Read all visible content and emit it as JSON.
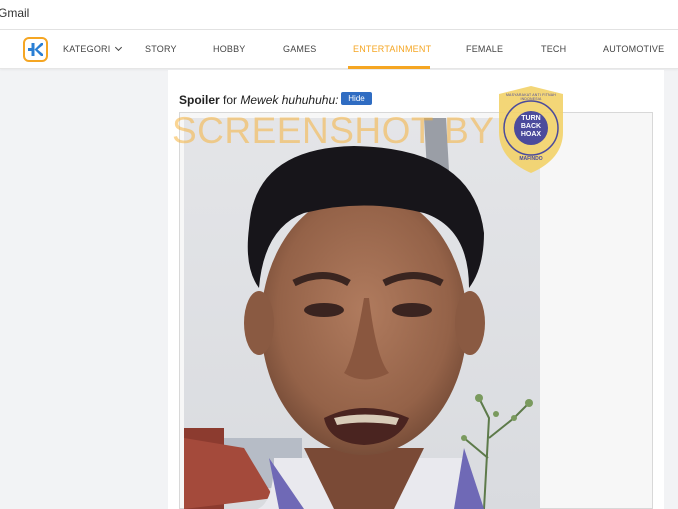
{
  "bookmarks": {
    "gmail": "Gmail"
  },
  "nav": {
    "items": [
      {
        "label": "KATEGORI"
      },
      {
        "label": "STORY"
      },
      {
        "label": "HOBBY"
      },
      {
        "label": "GAMES"
      },
      {
        "label": "ENTERTAINMENT"
      },
      {
        "label": "FEMALE"
      },
      {
        "label": "TECH"
      },
      {
        "label": "AUTOMOTIVE"
      }
    ],
    "active": "ENTERTAINMENT"
  },
  "spoiler": {
    "label": "Spoiler",
    "for_text": "for",
    "title": "Mewek huhuhuhu:",
    "hide_button": "Hide"
  },
  "watermark": {
    "text": "SCREENSHOT BY"
  },
  "badge": {
    "ring_text": "MASYARAKAT ANTI FITNAH INDONESIA",
    "line1": "TURN",
    "line2": "BACK",
    "line3": "HOAX",
    "bottom": "MAFINDO"
  },
  "colors": {
    "accent": "#f5a623",
    "hide_button": "#2f6cc2",
    "badge_gold": "#f2d26b",
    "badge_purple": "#4b4b9c"
  }
}
